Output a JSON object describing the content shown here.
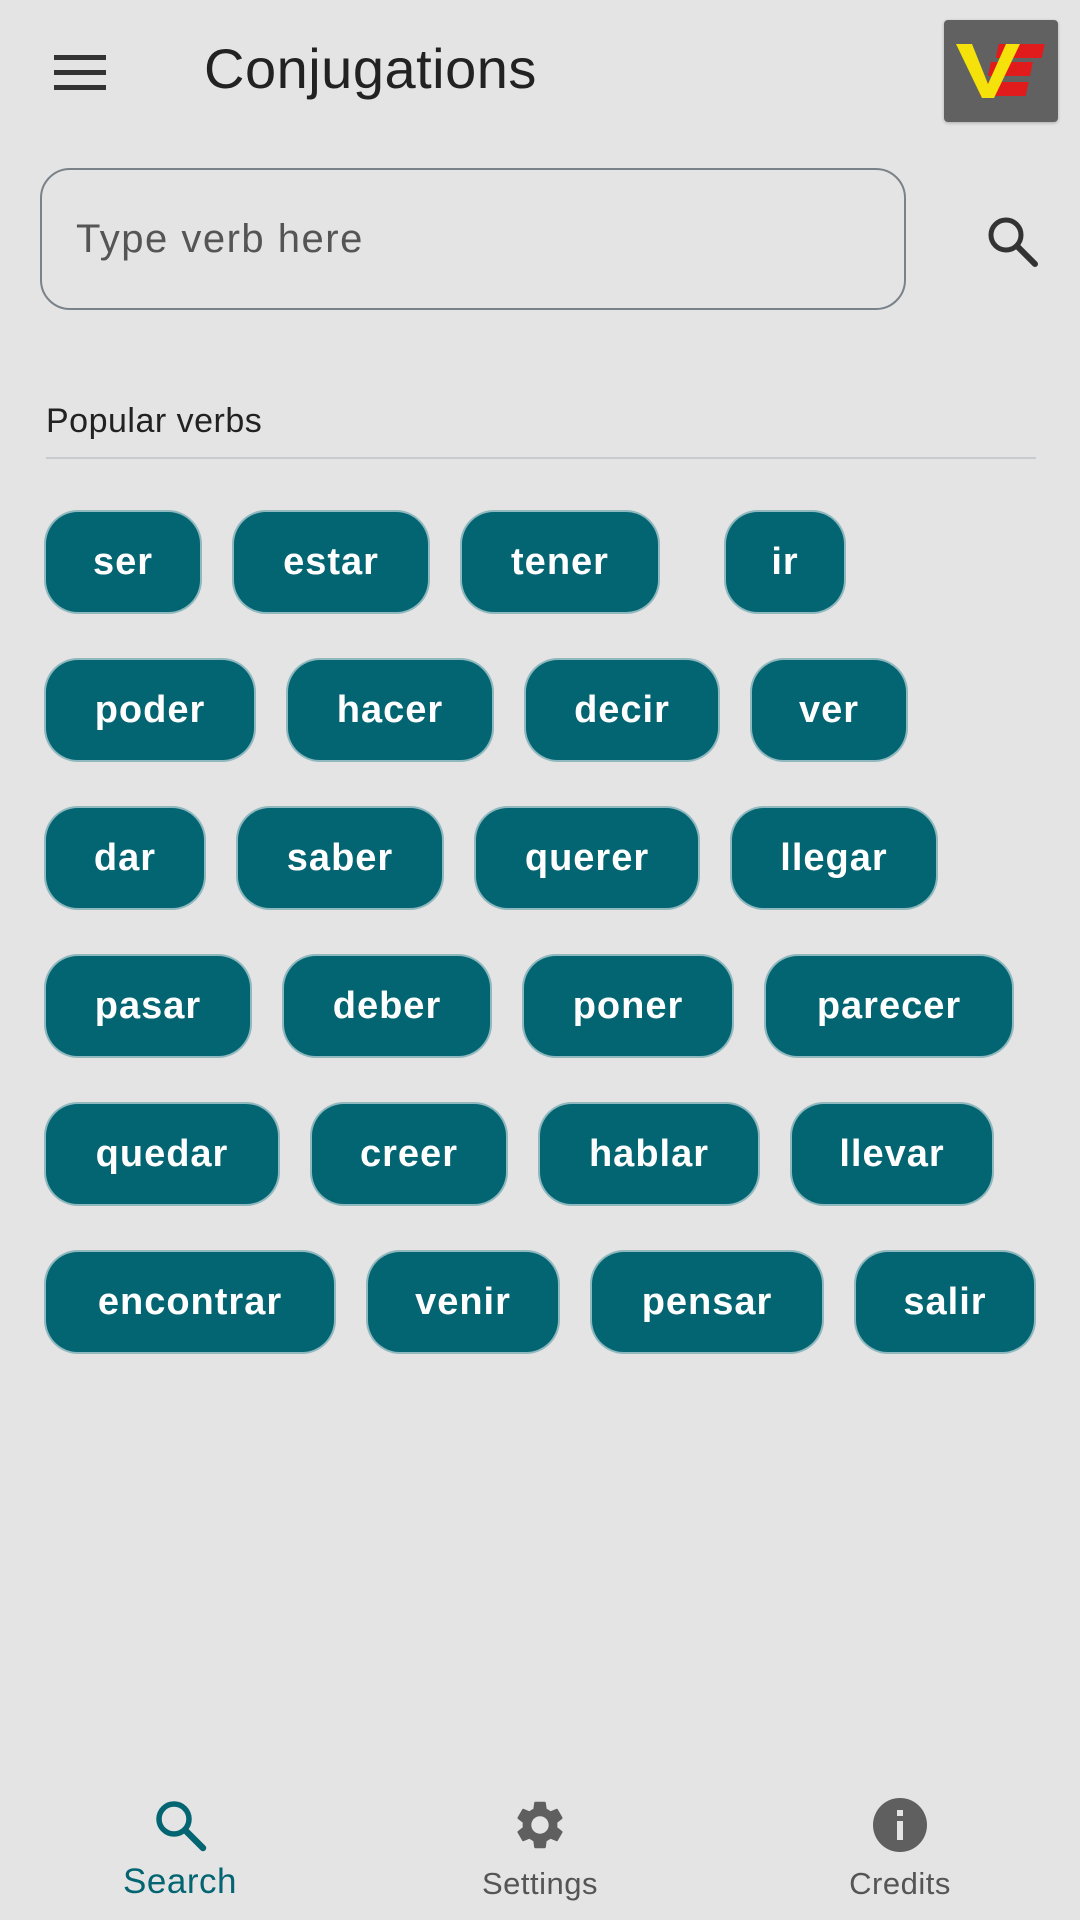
{
  "appbar": {
    "title": "Conjugations",
    "menu_icon": "menu-icon",
    "logo_icon": "ve-flag-logo-icon"
  },
  "search": {
    "placeholder": "Type verb here",
    "value": "",
    "button_icon": "search-icon"
  },
  "popular": {
    "title": "Popular verbs",
    "rows": [
      [
        "ser",
        "estar",
        "tener",
        "ir"
      ],
      [
        "poder",
        "hacer",
        "decir",
        "ver"
      ],
      [
        "dar",
        "saber",
        "querer",
        "llegar"
      ],
      [
        "pasar",
        "deber",
        "poner",
        "parecer"
      ],
      [
        "quedar",
        "creer",
        "hablar",
        "llevar"
      ],
      [
        "encontrar",
        "venir",
        "pensar",
        "salir"
      ]
    ]
  },
  "bottom_nav": {
    "items": [
      {
        "label": "Search",
        "icon": "search-icon",
        "active": true
      },
      {
        "label": "Settings",
        "icon": "gear-icon",
        "active": false
      },
      {
        "label": "Credits",
        "icon": "info-icon",
        "active": false
      }
    ]
  },
  "colors": {
    "background": "#e4e4e4",
    "accent": "#046572",
    "chip_text": "#ffffff",
    "logo_bg": "#616161",
    "logo_yellow": "#f5e20a",
    "logo_red": "#e11b1b",
    "inactive": "#555555"
  }
}
